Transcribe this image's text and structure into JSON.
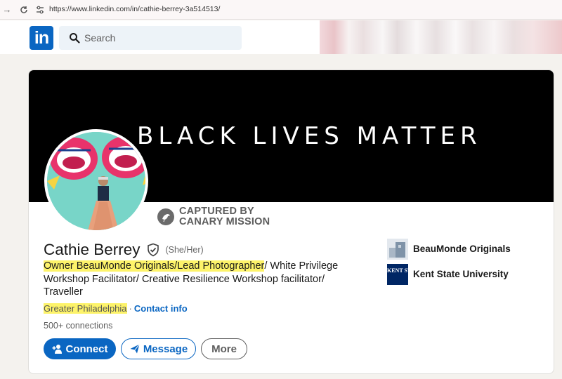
{
  "browser": {
    "url": "https://www.linkedin.com/in/cathie-berrey-3a514513/"
  },
  "header": {
    "logo_text": "in",
    "search_placeholder": "Search"
  },
  "profile": {
    "banner_text": "BLACK LIVES MATTER",
    "badge_text_line1": "CAPTURED BY",
    "badge_text_line2": "CANARY MISSION",
    "name": "Cathie Berrey",
    "pronouns": "(She/Her)",
    "headline_highlight": "Owner BeauMonde Originals/Lead Photographer",
    "headline_rest": "/ White Privilege Workshop Facilitator/ Creative Resilience Workshop facilitator/ Traveller",
    "location": "Greater Philadelphia",
    "separator": "·",
    "contact_info_label": "Contact info",
    "connections": "500+ connections"
  },
  "actions": {
    "connect_label": "Connect",
    "message_label": "Message",
    "more_label": "More"
  },
  "organizations": [
    {
      "name": "BeauMonde Originals",
      "icon": "company-logo"
    },
    {
      "name": "Kent State University",
      "icon": "university-logo",
      "logo_text": "KENT STATE"
    }
  ],
  "colors": {
    "brand_blue": "#0a66c2",
    "highlight_yellow": "#fdf36a",
    "banner_black": "#000000"
  }
}
